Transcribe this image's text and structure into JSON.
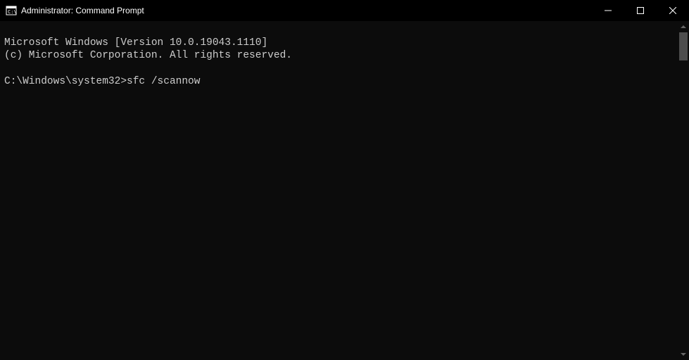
{
  "titlebar": {
    "title": "Administrator: Command Prompt"
  },
  "terminal": {
    "line1": "Microsoft Windows [Version 10.0.19043.1110]",
    "line2": "(c) Microsoft Corporation. All rights reserved.",
    "blank": "",
    "prompt": "C:\\Windows\\system32>",
    "command": "sfc /scannow"
  }
}
